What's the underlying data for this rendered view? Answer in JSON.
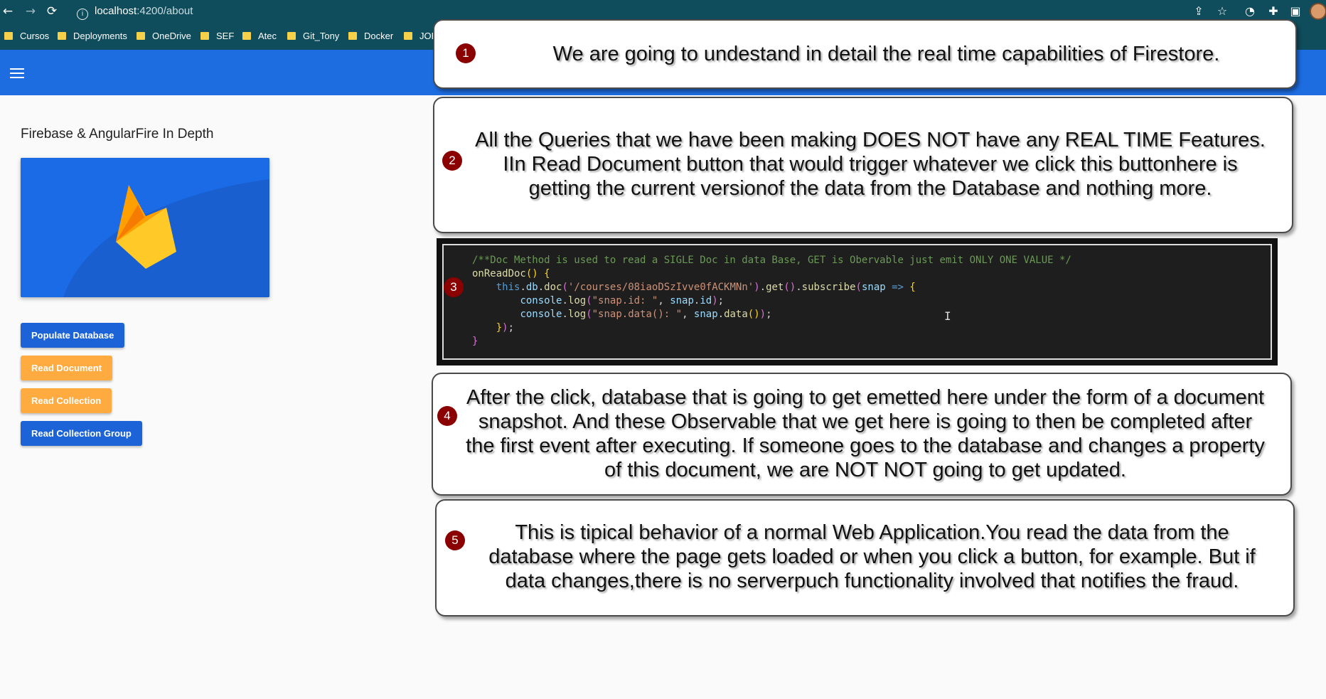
{
  "browser": {
    "url_host": "localhost",
    "url_path": ":4200/about",
    "bookmarks": [
      "Cursos",
      "Deployments",
      "OneDrive",
      "SEF",
      "Atec",
      "Git_Tony",
      "Docker",
      "JOB"
    ]
  },
  "app": {
    "page_title": "Firebase & AngularFire In Depth",
    "buttons": {
      "populate": "Populate Database",
      "read_document": "Read Document",
      "read_collection": "Read Collection",
      "read_collection_group": "Read Collection Group"
    },
    "colors": {
      "toolbar": "#1d6ce0",
      "primary_button": "#1b63d6",
      "accent_button": "#ffab40"
    }
  },
  "callouts": [
    {
      "number": "1",
      "text": "We are going to undestand in detail the real time capabilities of Firestore."
    },
    {
      "number": "2",
      "lines": [
        "All the Queries that we have been making DOES NOT have any REAL TIME Features.",
        "IIn Read Document button that would trigger whatever we click this buttonhere is",
        "getting the current versionof the data from the Database and nothing more."
      ]
    },
    {
      "number": "3"
    },
    {
      "number": "4",
      "lines": [
        "After the click, database that is going to get emetted here under the form of a document",
        "snapshot. And these Observable that we get here is going to then be completed after",
        "the first event after executing. If someone goes to the database and changes a property",
        "of this document, we are NOT NOT going to get updated."
      ]
    },
    {
      "number": "5",
      "lines": [
        "This is tipical behavior of a normal Web Application.You read the data from the",
        "database where the page gets loaded or when you click a button, for example. But if",
        "data changes,there is no serverpuch  functionality involved that notifies the fraud."
      ]
    }
  ],
  "code": {
    "comment": "/**Doc Method is used to read a SIGLE Doc in data Base, GET is Obervable just emit ONLY ONE VALUE */",
    "fn_name": "onReadDoc",
    "path": "'/courses/08iaoDSzIvve0fACKMNn'",
    "log1_str": "\"snap.id: \"",
    "log2_str": "\"snap.data(): \""
  }
}
